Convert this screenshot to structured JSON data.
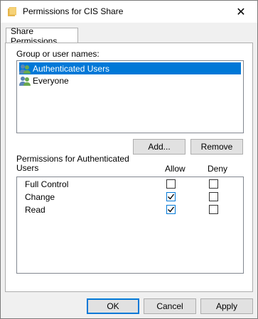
{
  "window": {
    "title": "Permissions for CIS Share"
  },
  "tab": {
    "label": "Share Permissions"
  },
  "group": {
    "label": "Group or user names:",
    "users": [
      {
        "name": "Authenticated Users",
        "selected": true
      },
      {
        "name": "Everyone",
        "selected": false
      }
    ]
  },
  "buttons": {
    "add": "Add...",
    "remove": "Remove",
    "ok": "OK",
    "cancel": "Cancel",
    "apply": "Apply"
  },
  "permissions": {
    "label": "Permissions for Authenticated Users",
    "allow_header": "Allow",
    "deny_header": "Deny",
    "rows": [
      {
        "name": "Full Control",
        "allow": false,
        "deny": false
      },
      {
        "name": "Change",
        "allow": true,
        "deny": false
      },
      {
        "name": "Read",
        "allow": true,
        "deny": false
      }
    ]
  },
  "colors": {
    "accent": "#0078d7",
    "selection": "#0078d7"
  }
}
